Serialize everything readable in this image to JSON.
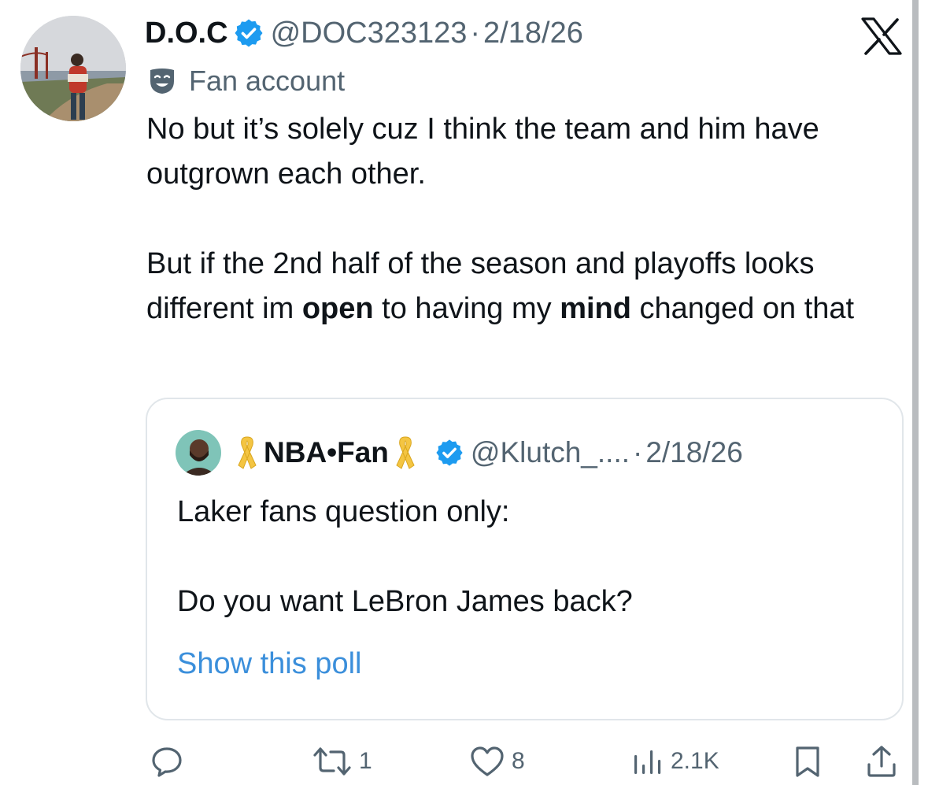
{
  "tweet": {
    "author_name": "D.O.C",
    "handle": "@DOC323123",
    "separator": "·",
    "date": "2/18/26",
    "label": "Fan account",
    "paragraph1": "No but it’s solely cuz I think the team and him have outgrown each other.",
    "p2_part1": "But if the 2nd half of the season and playoffs looks different im ",
    "p2_bold1": "open",
    "p2_part2": " to having my ",
    "p2_bold2": "mind",
    "p2_part3": " changed on that"
  },
  "quoted": {
    "author_name": "NBA•Fan",
    "handle": "@Klutch_....",
    "separator": "·",
    "date": "2/18/26",
    "line1": "Laker fans question only:",
    "line2": "Do you want LeBron James back?",
    "poll_link": "Show this poll"
  },
  "actions": {
    "reply_count": "",
    "retweet_count": "1",
    "like_count": "8",
    "views_count": "2.1K"
  },
  "icons": {
    "verified": "verified-badge-icon",
    "fan_account": "theater-mask-icon",
    "ribbon": "yellow-ribbon-icon",
    "brand": "x-logo-icon",
    "reply": "reply-bubble-icon",
    "retweet": "retweet-icon",
    "like": "heart-icon",
    "views": "views-bars-icon",
    "bookmark": "bookmark-icon",
    "share": "share-icon"
  },
  "colors": {
    "verified": "#1d9bf0",
    "link": "#3b8fdb",
    "secondary_text": "#536471",
    "ribbon": "#f4c542",
    "border": "#e1e6ea"
  }
}
